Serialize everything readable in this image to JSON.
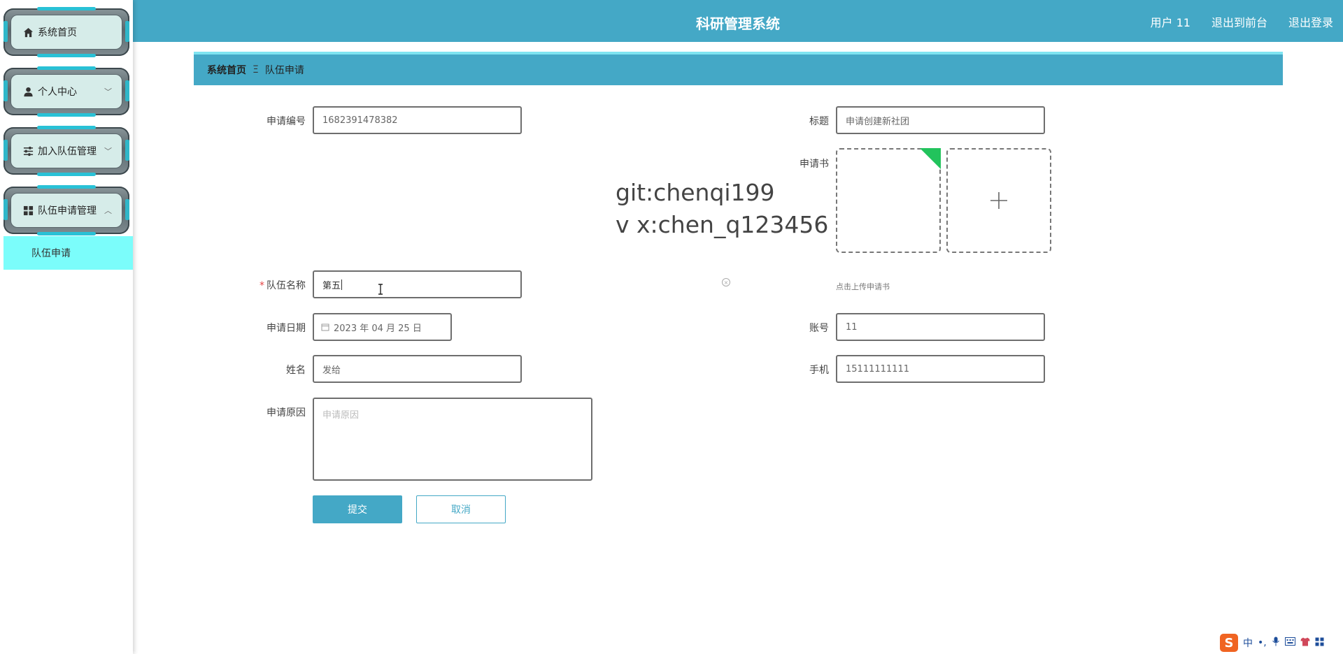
{
  "app": {
    "title": "科研管理系统"
  },
  "top_links": {
    "user": "用户 11",
    "front": "退出到前台",
    "logout": "退出登录"
  },
  "sidebar": {
    "items": [
      {
        "label": "系统首页",
        "icon": "home-icon"
      },
      {
        "label": "个人中心",
        "icon": "user-icon",
        "chevron": "﹀"
      },
      {
        "label": "加入队伍管理",
        "icon": "sliders-icon",
        "chevron": "﹀"
      },
      {
        "label": "队伍申请管理",
        "icon": "grid-icon",
        "chevron": "︿"
      }
    ],
    "sub_item": "队伍申请"
  },
  "breadcrumb": {
    "home": "系统首页",
    "sep": "Ξ",
    "current": "队伍申请"
  },
  "form": {
    "apply_no": {
      "label": "申请编号",
      "value": "1682391478382"
    },
    "title": {
      "label": "标题",
      "value": "申请创建新社团"
    },
    "letter": {
      "label": "申请书",
      "hint": "点击上传申请书"
    },
    "team_name": {
      "label": "队伍名称",
      "required": "*",
      "value": "第五"
    },
    "apply_date": {
      "label": "申请日期",
      "value": "2023 年 04 月 25 日"
    },
    "account": {
      "label": "账号",
      "value": "11"
    },
    "name": {
      "label": "姓名",
      "value": "发给"
    },
    "phone": {
      "label": "手机",
      "value": "15111111111"
    },
    "reason": {
      "label": "申请原因",
      "placeholder": "申请原因"
    },
    "submit": "提交",
    "cancel": "取消"
  },
  "watermark": {
    "line1": "git:chenqi199",
    "line2": "v x:chen_q123456"
  },
  "ime": {
    "logo": "S",
    "mode": "中",
    "punct": "•,",
    "icons": [
      "mic-icon",
      "keyboard-icon",
      "shirt-icon",
      "apps-icon"
    ]
  }
}
